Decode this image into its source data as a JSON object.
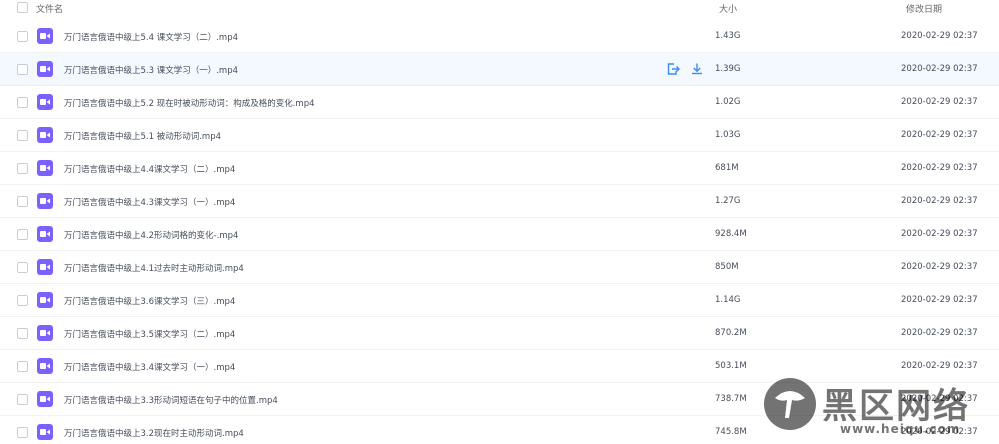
{
  "header": {
    "col_name": "文件名",
    "col_size": "大小",
    "col_date": "修改日期"
  },
  "files": [
    {
      "name": "万门语言俄语中级上5.4 课文学习（二）.mp4",
      "size": "1.43G",
      "date": "2020-02-29 02:37"
    },
    {
      "name": "万门语言俄语中级上5.3 课文学习（一）.mp4",
      "size": "1.39G",
      "date": "2020-02-29 02:37"
    },
    {
      "name": "万门语言俄语中级上5.2 现在时被动形动词：构成及格的变化.mp4",
      "size": "1.02G",
      "date": "2020-02-29 02:37"
    },
    {
      "name": "万门语言俄语中级上5.1 被动形动词.mp4",
      "size": "1.03G",
      "date": "2020-02-29 02:37"
    },
    {
      "name": "万门语言俄语中级上4.4课文学习（二）.mp4",
      "size": "681M",
      "date": "2020-02-29 02:37"
    },
    {
      "name": "万门语言俄语中级上4.3课文学习（一）.mp4",
      "size": "1.27G",
      "date": "2020-02-29 02:37"
    },
    {
      "name": "万门语言俄语中级上4.2形动词格的变化-.mp4",
      "size": "928.4M",
      "date": "2020-02-29 02:37"
    },
    {
      "name": "万门语言俄语中级上4.1过去时主动形动词.mp4",
      "size": "850M",
      "date": "2020-02-29 02:37"
    },
    {
      "name": "万门语言俄语中级上3.6课文学习（三）.mp4",
      "size": "1.14G",
      "date": "2020-02-29 02:37"
    },
    {
      "name": "万门语言俄语中级上3.5课文学习（二）.mp4",
      "size": "870.2M",
      "date": "2020-02-29 02:37"
    },
    {
      "name": "万门语言俄语中级上3.4课文学习（一）.mp4",
      "size": "503.1M",
      "date": "2020-02-29 02:37"
    },
    {
      "name": "万门语言俄语中级上3.3形动词短语在句子中的位置.mp4",
      "size": "738.7M",
      "date": "2020-02-29 02:37"
    },
    {
      "name": "万门语言俄语中级上3.2现在时主动形动词.mp4",
      "size": "745.8M",
      "date": "2020-02-29 02:37"
    }
  ],
  "hover_row": 1,
  "icons": {
    "file": "video-file-icon",
    "share": "share-icon",
    "download": "download-icon"
  },
  "colors": {
    "accent": "#3b8cf3",
    "video_icon": "#7b61ff",
    "hover_bg": "#f4f8ff"
  },
  "watermark": {
    "title": "黑区网络",
    "url": "www.heiqu.com"
  }
}
